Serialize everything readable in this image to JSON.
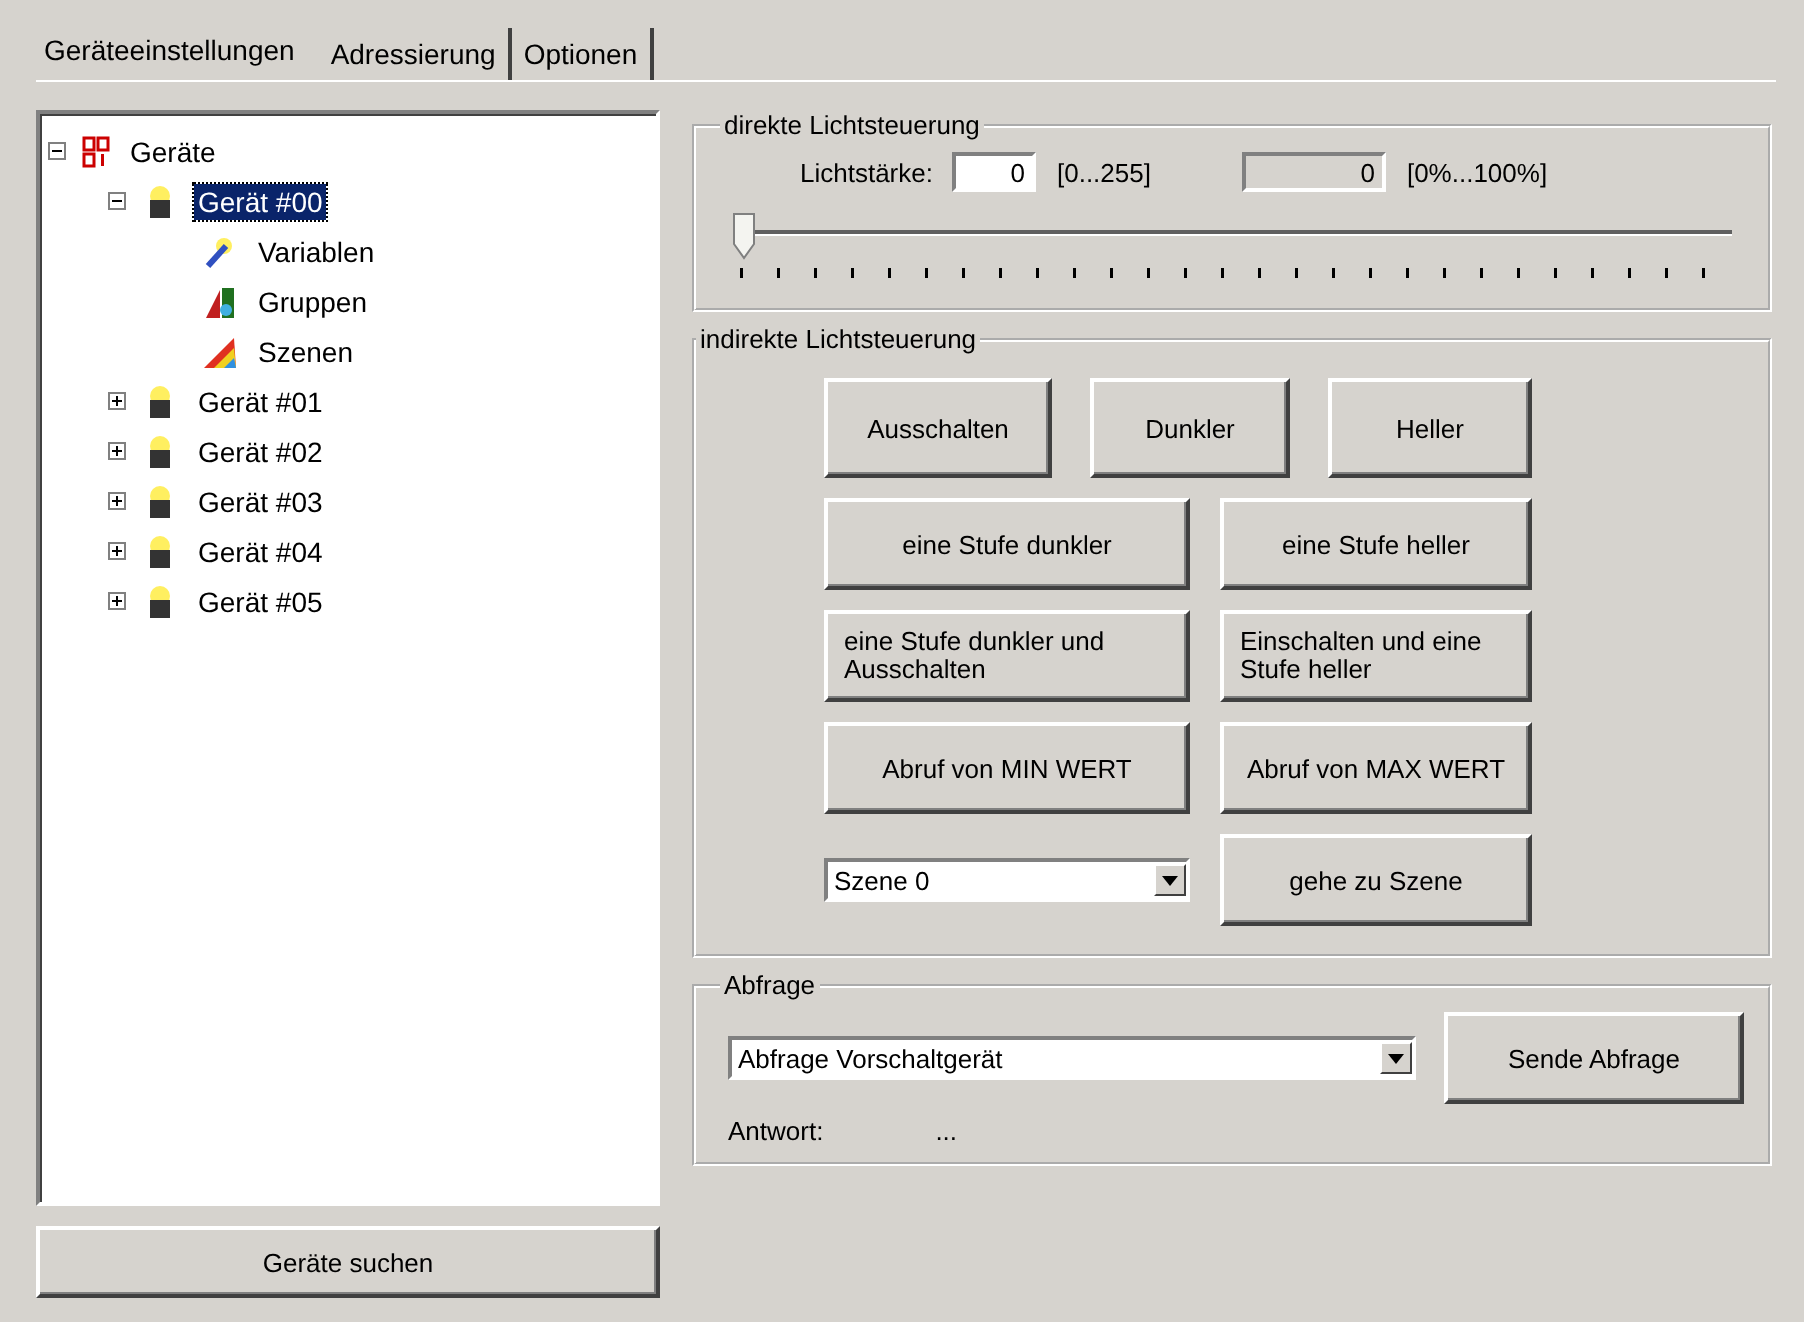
{
  "tabs": [
    {
      "label": "Geräteeinstellungen",
      "selected": true
    },
    {
      "label": "Adressierung",
      "selected": false
    },
    {
      "label": "Optionen",
      "selected": false
    }
  ],
  "tree": [
    {
      "label": "Geräte",
      "kind": "root",
      "expanded": true,
      "selected": false,
      "children": [
        {
          "label": "Gerät #00",
          "kind": "device",
          "expanded": true,
          "selected": true,
          "children": [
            {
              "label": "Variablen",
              "kind": "variables",
              "selected": false
            },
            {
              "label": "Gruppen",
              "kind": "groups",
              "selected": false
            },
            {
              "label": "Szenen",
              "kind": "scenes",
              "selected": false
            }
          ]
        },
        {
          "label": "Gerät #01",
          "kind": "device",
          "expanded": false,
          "selected": false
        },
        {
          "label": "Gerät #02",
          "kind": "device",
          "expanded": false,
          "selected": false
        },
        {
          "label": "Gerät #03",
          "kind": "device",
          "expanded": false,
          "selected": false
        },
        {
          "label": "Gerät #04",
          "kind": "device",
          "expanded": false,
          "selected": false
        },
        {
          "label": "Gerät #05",
          "kind": "device",
          "expanded": false,
          "selected": false
        }
      ]
    }
  ],
  "search_button": "Geräte suchen",
  "direct": {
    "title": "direkte Lichtsteuerung",
    "label": "Lichtstärke:",
    "value": "0",
    "range": "[0...255]",
    "percent_value": "0",
    "percent_range": "[0%...100%]",
    "slider": {
      "level": 0
    }
  },
  "indirect": {
    "title": "indirekte Lichtsteuerung",
    "rows": [
      [
        "Ausschalten",
        "Dunkler",
        "Heller"
      ],
      [
        "eine Stufe dunkler",
        "eine Stufe heller"
      ],
      [
        "eine Stufe dunkler und Ausschalten",
        "Einschalten und eine Stufe heller"
      ],
      [
        "Abruf von MIN WERT",
        "Abruf von MAX WERT"
      ]
    ],
    "scene_select": "Szene 0",
    "scene_button": "gehe zu Szene"
  },
  "query": {
    "title": "Abfrage",
    "select": "Abfrage Vorschaltgerät",
    "send_button": "Sende Abfrage",
    "answer_label": "Antwort:",
    "answer": "..."
  }
}
